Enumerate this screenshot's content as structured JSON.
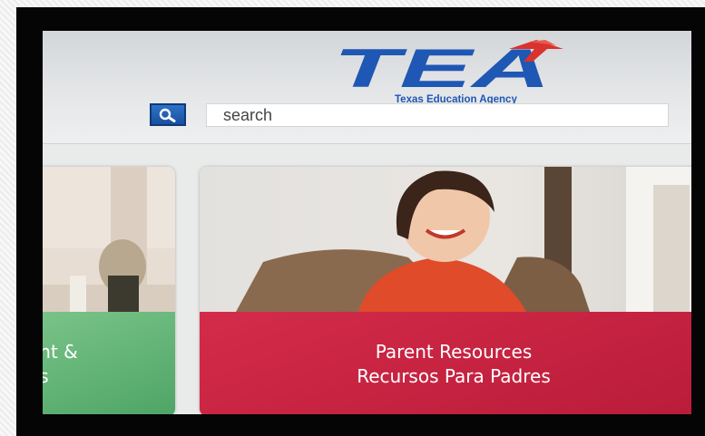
{
  "header": {
    "logo_text": "TEA",
    "logo_subtitle": "Texas Education Agency",
    "search_placeholder": "search"
  },
  "cards": [
    {
      "line1": "ent &",
      "line2": "es"
    },
    {
      "line1": "Parent Resources",
      "line2": "Recursos Para Padres"
    }
  ],
  "colors": {
    "brand_blue": "#1f57b4",
    "accent_red": "#d9332d",
    "card_green": "#5fb172",
    "card_red": "#c8223f"
  },
  "icons": {
    "search": "magnifier-icon"
  }
}
